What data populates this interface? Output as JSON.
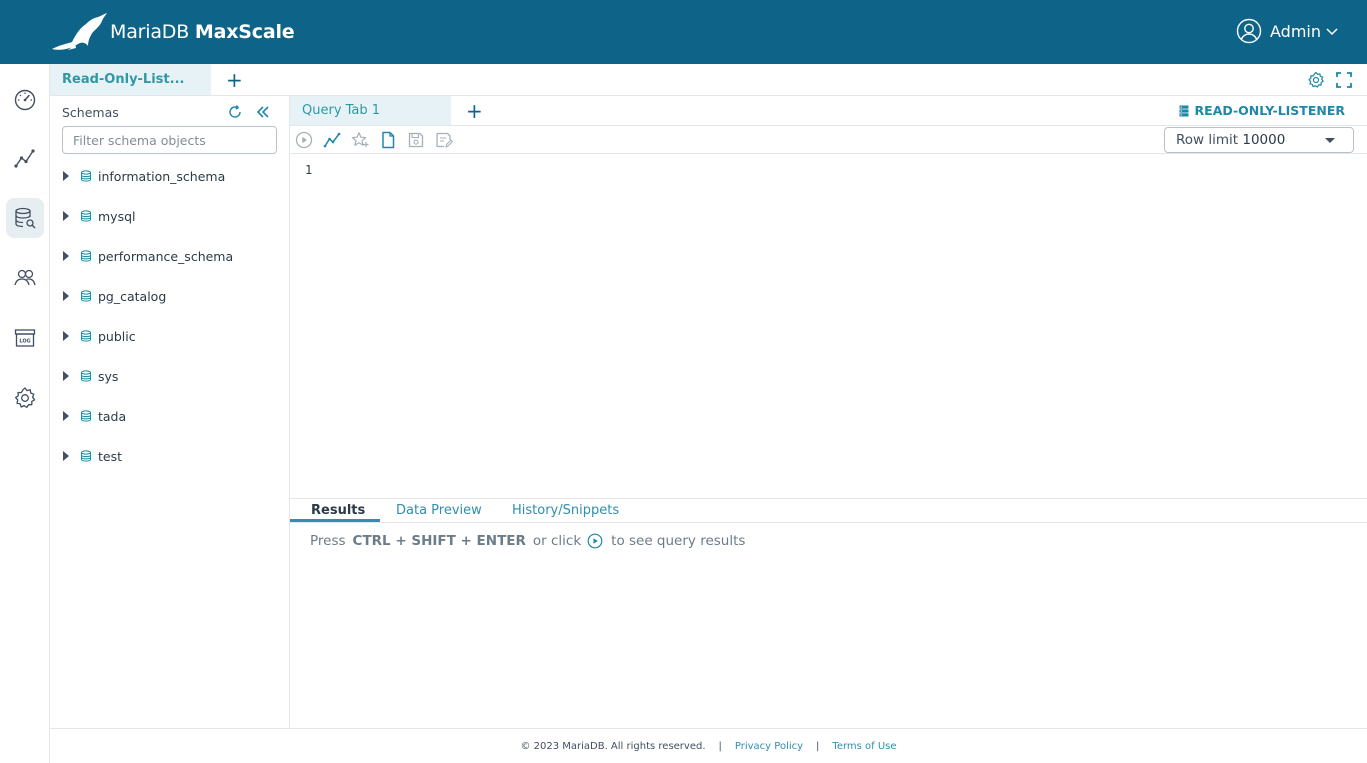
{
  "app": {
    "brand_light": "MariaDB",
    "brand_bold": "MaxScale",
    "user_name": "Admin"
  },
  "nav": {
    "items": [
      {
        "icon": "dashboard-icon",
        "active": false
      },
      {
        "icon": "visualization-icon",
        "active": false
      },
      {
        "icon": "query-editor-icon",
        "active": true
      },
      {
        "icon": "users-icon",
        "active": false
      },
      {
        "icon": "logs-archive-icon",
        "active": false
      },
      {
        "icon": "settings-icon",
        "active": false
      }
    ]
  },
  "worksheet": {
    "tab_label": "Read-Only-List...",
    "add_label": "+"
  },
  "sidebar": {
    "title": "Schemas",
    "filter_placeholder": "Filter schema objects",
    "schemas": [
      "information_schema",
      "mysql",
      "performance_schema",
      "pg_catalog",
      "public",
      "sys",
      "tada",
      "test"
    ]
  },
  "query": {
    "tab_label": "Query Tab 1",
    "add_label": "+",
    "listener_label": "READ-ONLY-LISTENER",
    "row_limit_label": "Row limit",
    "row_limit_value": "10000",
    "line_number": "1"
  },
  "results": {
    "tabs": [
      "Results",
      "Data Preview",
      "History/Snippets"
    ],
    "active_tab": "Results",
    "hint_press": "Press",
    "hint_shortcut": "CTRL + SHIFT + ENTER",
    "hint_or_click": "or click",
    "hint_tail": "to see query results"
  },
  "footer": {
    "copyright": "© 2023 MariaDB. All rights reserved.",
    "sep": "|",
    "privacy": "Privacy Policy",
    "terms": "Terms of Use"
  },
  "colors": {
    "appbar": "#0e6488",
    "accent": "#2f99a3",
    "link": "#2f8fae"
  }
}
